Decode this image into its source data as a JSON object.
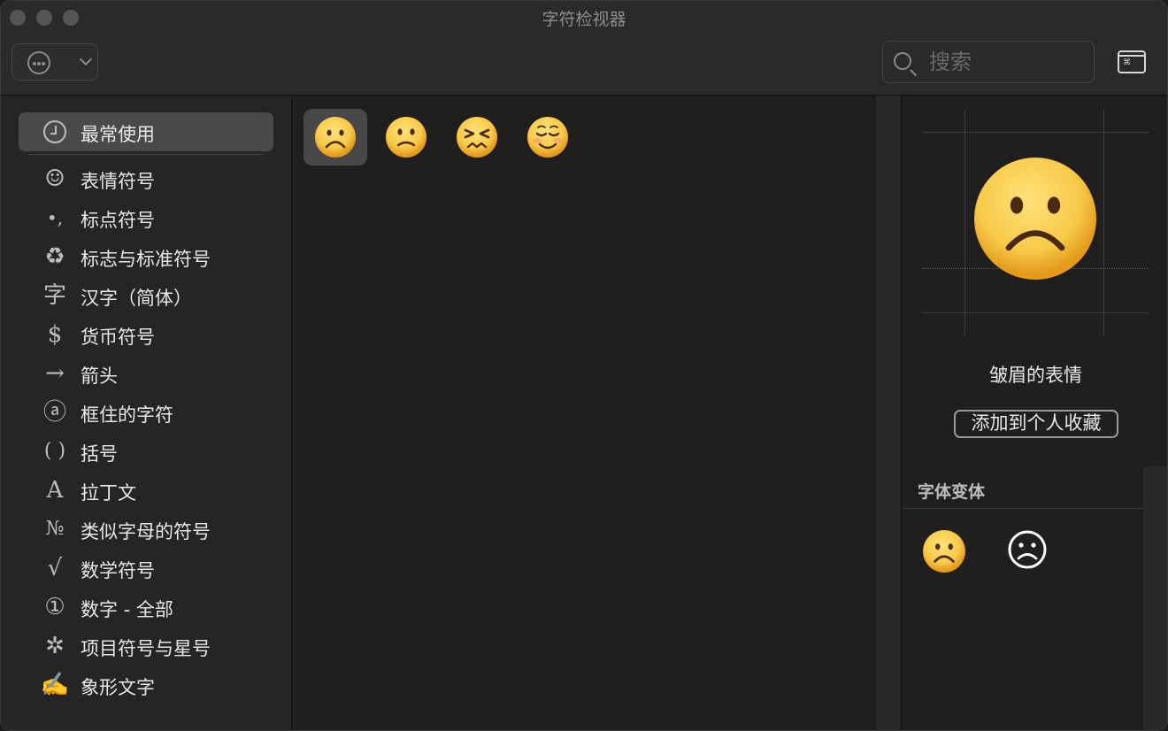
{
  "window": {
    "title": "字符检视器"
  },
  "toolbar": {
    "search_placeholder": "搜索",
    "kbd_label": "⌘"
  },
  "sidebar": {
    "items": [
      {
        "label": "最常使用",
        "icon": "clock-icon",
        "selected": true
      },
      {
        "label": "表情符号",
        "icon": "smiley-icon",
        "glyph": "☺"
      },
      {
        "label": "标点符号",
        "icon": "punctuation-icon",
        "glyph": "•,"
      },
      {
        "label": "标志与标准符号",
        "icon": "recycle-icon",
        "glyph": "♻"
      },
      {
        "label": "汉字（简体）",
        "icon": "hanzi-icon",
        "glyph": "字"
      },
      {
        "label": "货币符号",
        "icon": "dollar-icon",
        "glyph": "$"
      },
      {
        "label": "箭头",
        "icon": "arrow-icon",
        "glyph": "→"
      },
      {
        "label": "框住的字符",
        "icon": "circled-a-icon",
        "glyph": "ⓐ"
      },
      {
        "label": "括号",
        "icon": "parentheses-icon",
        "glyph": "( )"
      },
      {
        "label": "拉丁文",
        "icon": "latin-a-icon",
        "glyph": "A"
      },
      {
        "label": "类似字母的符号",
        "icon": "numero-icon",
        "glyph": "№"
      },
      {
        "label": "数学符号",
        "icon": "sqrt-icon",
        "glyph": "√"
      },
      {
        "label": "数字 - 全部",
        "icon": "circled-one-icon",
        "glyph": "①"
      },
      {
        "label": "项目符号与星号",
        "icon": "asterisk-icon",
        "glyph": "✲"
      },
      {
        "label": "象形文字",
        "icon": "writing-hand-icon",
        "glyph": "✍"
      }
    ]
  },
  "glyphs": [
    {
      "name": "frowning-face-emoji",
      "selected": true
    },
    {
      "name": "slightly-frowning-face-emoji"
    },
    {
      "name": "persevering-face-emoji"
    },
    {
      "name": "smiling-face-emoji"
    }
  ],
  "detail": {
    "character_name": "皱眉的表情",
    "add_favorite_label": "添加到个人收藏",
    "font_variants_label": "字体变体",
    "text_variant_glyph": "☹"
  },
  "colors": {
    "emoji_face": "#f7c948",
    "emoji_shade": "#e49b1c",
    "selected_bg": "#4b4a48"
  }
}
